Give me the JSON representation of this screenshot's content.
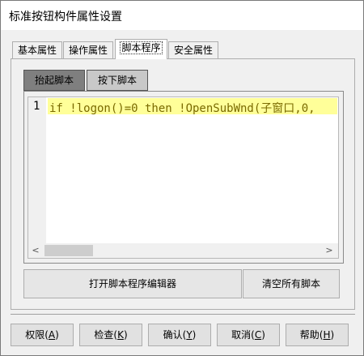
{
  "window": {
    "title": "标准按钮构件属性设置"
  },
  "tabs": [
    {
      "label": "基本属性"
    },
    {
      "label": "操作属性"
    },
    {
      "label": "脚本程序"
    },
    {
      "label": "安全属性"
    }
  ],
  "subtabs": [
    {
      "label": "抬起脚本"
    },
    {
      "label": "按下脚本"
    }
  ],
  "editor": {
    "line_number": "1",
    "code": "if !logon()=0 then !OpenSubWnd(子窗口,0,"
  },
  "scrollbar": {
    "left_arrow": "<",
    "right_arrow": ">"
  },
  "actions": {
    "open_editor": "打开脚本程序编辑器",
    "clear_all": "清空所有脚本"
  },
  "buttons": [
    {
      "label": "权限",
      "key": "A"
    },
    {
      "label": "检查",
      "key": "K"
    },
    {
      "label": "确认",
      "key": "Y"
    },
    {
      "label": "取消",
      "key": "C"
    },
    {
      "label": "帮助",
      "key": "H"
    }
  ]
}
